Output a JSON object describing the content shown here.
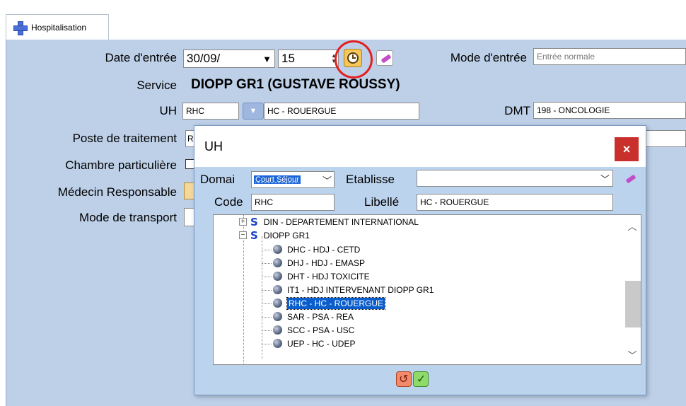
{
  "tab": {
    "label": "Hospitalisation"
  },
  "form": {
    "date_label": "Date d'entrée",
    "date_value": "30/09/",
    "hour_value": "15",
    "mode_label": "Mode d'entrée",
    "mode_value": "Entrée normale",
    "service_label": "Service",
    "service_value": "DIOPP GR1 (GUSTAVE ROUSSY)",
    "uh_label": "UH",
    "uh_code": "RHC",
    "uh_name": "HC - ROUERGUE",
    "dmt_label": "DMT",
    "dmt_value": "198 - ONCOLOGIE",
    "poste_label": "Poste de traitement",
    "poste_value": "R",
    "chambre_label": "Chambre particulière",
    "medecin_label": "Médecin Responsable",
    "transport_label": "Mode de transport"
  },
  "dialog": {
    "title": "UH",
    "close_label": "×",
    "domaine_label": "Domai",
    "domaine_value": "Court Séjour",
    "etab_label": "Etablisse",
    "etab_value": "",
    "code_label": "Code",
    "code_value": "RHC",
    "libelle_label": "Libellé",
    "libelle_value": "HC - ROUERGUE",
    "tree": [
      {
        "label": "DIN - DEPARTEMENT INTERNATIONAL",
        "level": 0,
        "expander": "+"
      },
      {
        "label": "DIOPP GR1",
        "level": 0,
        "expander": "−"
      },
      {
        "label": "DHC - HDJ - CETD",
        "level": 1
      },
      {
        "label": "DHJ - HDJ - EMASP",
        "level": 1
      },
      {
        "label": "DHT - HDJ TOXICITE",
        "level": 1
      },
      {
        "label": "IT1 - HDJ INTERVENANT DIOPP GR1",
        "level": 1
      },
      {
        "label": "RHC - HC - ROUERGUE",
        "level": 1,
        "selected": true
      },
      {
        "label": "SAR - PSA - REA",
        "level": 1
      },
      {
        "label": "SCC - PSA - USC",
        "level": 1
      },
      {
        "label": "UEP - HC - UDEP",
        "level": 1
      }
    ]
  },
  "icons": {
    "tab": "medical-cross-icon",
    "clock": "clock-icon",
    "eraser": "eraser-icon",
    "dropdown": "dropdown-icon",
    "service_group": "s-group-icon",
    "unit": "unit-ball-icon",
    "cancel": "undo-icon",
    "ok": "checkmark-icon"
  },
  "colors": {
    "panel_bg": "#bdd0e8",
    "dialog_bg": "#bcd3ee",
    "highlight_circle": "#e41e1e",
    "close_button": "#c9302c",
    "selection": "#0a5dcc"
  }
}
